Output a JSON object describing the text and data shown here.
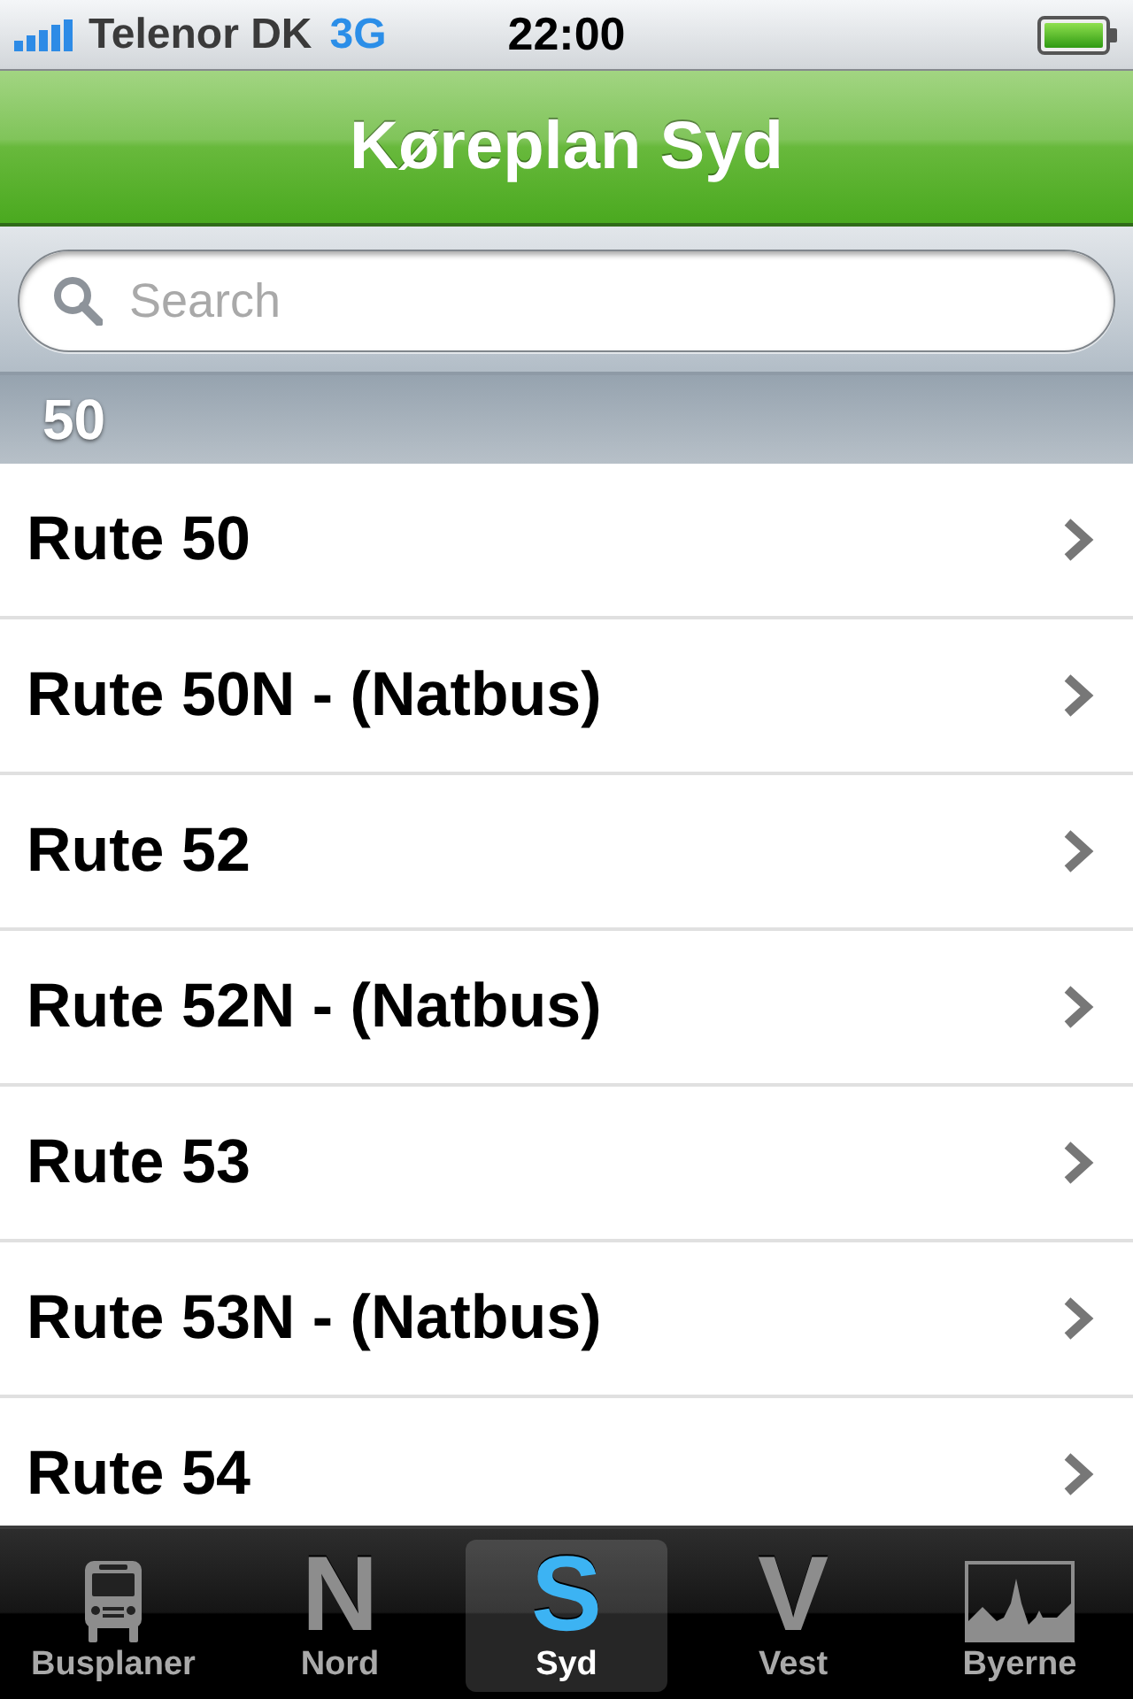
{
  "status_bar": {
    "carrier": "Telenor DK",
    "network": "3G",
    "time": "22:00"
  },
  "nav_bar": {
    "title": "Køreplan Syd"
  },
  "search": {
    "placeholder": "Search"
  },
  "sections": [
    {
      "header": "50",
      "rows": [
        {
          "label": "Rute 50"
        },
        {
          "label": "Rute 50N - (Natbus)"
        },
        {
          "label": "Rute 52"
        },
        {
          "label": "Rute 52N - (Natbus)"
        },
        {
          "label": "Rute 53"
        },
        {
          "label": "Rute 53N - (Natbus)"
        },
        {
          "label": "Rute 54"
        }
      ]
    }
  ],
  "tab_bar": {
    "tabs": [
      {
        "kind": "bus",
        "label": "Busplaner",
        "selected": false
      },
      {
        "kind": "letter",
        "letter": "N",
        "label": "Nord",
        "selected": false
      },
      {
        "kind": "letter",
        "letter": "S",
        "label": "Syd",
        "selected": true
      },
      {
        "kind": "letter",
        "letter": "V",
        "label": "Vest",
        "selected": false
      },
      {
        "kind": "skyline",
        "label": "Byerne",
        "selected": false
      }
    ]
  }
}
